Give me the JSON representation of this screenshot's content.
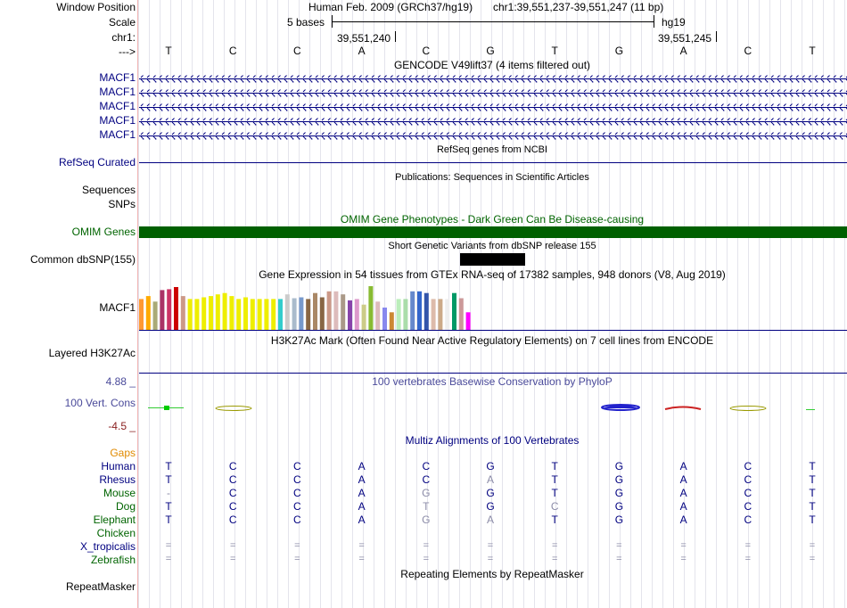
{
  "labels": {
    "window_position": "Window Position",
    "scale": "Scale",
    "chr": "chr1:",
    "arrow": "--->",
    "macf1": "MACF1",
    "refseq": "RefSeq Curated",
    "sequences": "Sequences",
    "snps": "SNPs",
    "omim": "OMIM Genes",
    "dbsnp": "Common dbSNP(155)",
    "gtex": "MACF1",
    "h3k27ac": "Layered H3K27Ac",
    "phylop_max": "4.88 _",
    "phylop": "100 Vert. Cons",
    "phylop_min": "-4.5 _",
    "repeatmasker": "RepeatMasker"
  },
  "header": {
    "assembly": "Human Feb. 2009 (GRCh37/hg19)",
    "position": "chr1:39,551,237-39,551,247 (11 bp)",
    "scale_text": "5 bases",
    "scale_db": "hg19",
    "coord1": "39,551,240",
    "coord2": "39,551,245"
  },
  "bases": [
    "T",
    "C",
    "C",
    "A",
    "C",
    "G",
    "T",
    "G",
    "A",
    "C",
    "T"
  ],
  "tracks": {
    "gencode": "GENCODE V49lift37 (4 items filtered out)",
    "refseq": "RefSeq genes from NCBI",
    "publications": "Publications: Sequences in Scientific Articles",
    "omim": "OMIM Gene Phenotypes - Dark Green Can Be Disease-causing",
    "dbsnp": "Short Genetic Variants from dbSNP release 155",
    "gtex": "Gene Expression in 54 tissues from GTEx RNA-seq of 17382 samples, 948 donors (V8, Aug 2019)",
    "h3k27ac": "H3K27Ac Mark (Often Found Near Active Regulatory Elements) on 7 cell lines from ENCODE",
    "phylop": "100 vertebrates Basewise Conservation by PhyloP",
    "multiz": "Multiz Alignments of 100 Vertebrates",
    "repeatmasker": "Repeating Elements by RepeatMasker"
  },
  "species": [
    {
      "name": "Gaps",
      "color": "#e08a00",
      "bases": []
    },
    {
      "name": "Human",
      "color": "#000080",
      "bases": [
        "T",
        "C",
        "C",
        "A",
        "C",
        "G",
        "T",
        "G",
        "A",
        "C",
        "T"
      ]
    },
    {
      "name": "Rhesus",
      "color": "#000080",
      "bases": [
        "T",
        "C",
        "C",
        "A",
        "C",
        "A",
        "T",
        "G",
        "A",
        "C",
        "T"
      ]
    },
    {
      "name": "Mouse",
      "color": "#006400",
      "bases": [
        "-",
        "C",
        "C",
        "A",
        "G",
        "G",
        "T",
        "G",
        "A",
        "C",
        "T"
      ]
    },
    {
      "name": "Dog",
      "color": "#006400",
      "bases": [
        "T",
        "C",
        "C",
        "A",
        "T",
        "G",
        "C",
        "G",
        "A",
        "C",
        "T"
      ]
    },
    {
      "name": "Elephant",
      "color": "#006400",
      "bases": [
        "T",
        "C",
        "C",
        "A",
        "G",
        "A",
        "T",
        "G",
        "A",
        "C",
        "T"
      ]
    },
    {
      "name": "Chicken",
      "color": "#006400",
      "bases": []
    },
    {
      "name": "X_tropicalis",
      "color": "#000080",
      "bases": [
        "=",
        "=",
        "=",
        "=",
        "=",
        "=",
        "=",
        "=",
        "=",
        "=",
        "="
      ]
    },
    {
      "name": "Zebrafish",
      "color": "#006400",
      "bases": [
        "=",
        "=",
        "=",
        "=",
        "=",
        "=",
        "=",
        "=",
        "=",
        "=",
        "="
      ]
    }
  ],
  "gtex_colors": [
    "#ff9933",
    "#ffaa00",
    "#aaaa77",
    "#aa3366",
    "#cc3366",
    "#cc0000",
    "#cc9988",
    "#eeee00",
    "#eeee00",
    "#eeee00",
    "#eeee00",
    "#eeee00",
    "#eeee00",
    "#eeee00",
    "#eeee00",
    "#eeee00",
    "#eeee00",
    "#eeee00",
    "#eeee00",
    "#eeee00",
    "#33cccc",
    "#cccccc",
    "#aabbcc",
    "#7799cc",
    "#886644",
    "#aa8866",
    "#886644",
    "#cc9988",
    "#ddbbbb",
    "#aa9988",
    "#8844aa",
    "#dd99cc",
    "#cccc88",
    "#88bb33",
    "#ddbbbb",
    "#8888ee",
    "#cc8833",
    "#bbeebb",
    "#aaddaa",
    "#6688cc",
    "#3366cc",
    "#3355aa",
    "#ddbbaa",
    "#ccaa88",
    "#eeeeee",
    "#009966",
    "#cc9999",
    "#ff00ff"
  ],
  "gtex_levels": [
    0.72,
    0.79,
    0.66,
    0.93,
    0.95,
    1.0,
    0.79,
    0.72,
    0.72,
    0.76,
    0.79,
    0.83,
    0.86,
    0.79,
    0.72,
    0.76,
    0.72,
    0.72,
    0.72,
    0.72,
    0.72,
    0.83,
    0.74,
    0.76,
    0.72,
    0.86,
    0.76,
    0.9,
    0.9,
    0.83,
    0.69,
    0.72,
    0.59,
    1.02,
    0.66,
    0.52,
    0.41,
    0.72,
    0.72,
    0.9,
    0.9,
    0.86,
    0.72,
    0.72,
    0.72,
    0.86,
    0.74,
    0.41
  ],
  "colors": {
    "navy": "#000080",
    "omim": "#006000",
    "dbsnp": "#000000"
  }
}
